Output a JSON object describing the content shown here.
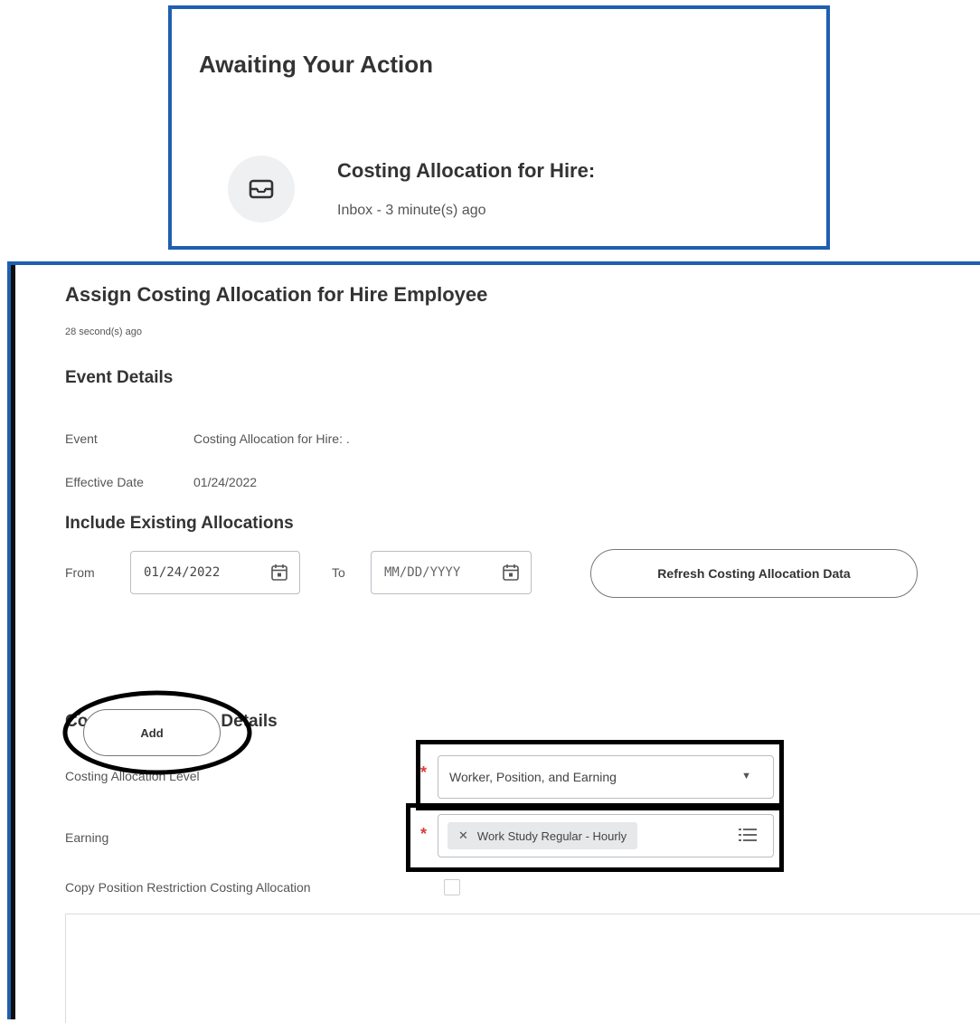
{
  "awaiting": {
    "title": "Awaiting Your Action",
    "item_title": "Costing Allocation for Hire:",
    "item_subtitle": "Inbox - 3 minute(s) ago"
  },
  "task": {
    "title": "Assign Costing Allocation for Hire Employee",
    "timestamp": "28 second(s) ago",
    "event_details": {
      "heading": "Event Details",
      "event_label": "Event",
      "event_value": "Costing Allocation for Hire: .",
      "effective_date_label": "Effective Date",
      "effective_date_value": "01/24/2022"
    },
    "existing": {
      "heading": "Include Existing Allocations",
      "from_label": "From",
      "from_value": "01/24/2022",
      "to_label": "To",
      "to_placeholder": "MM/DD/YYYY",
      "refresh_button": "Refresh Costing Allocation Data"
    },
    "details": {
      "heading": "Costing Allocation Details",
      "level_label": "Costing Allocation Level",
      "level_value": "Worker, Position, and Earning",
      "earning_label": "Earning",
      "earning_value": "Work Study Regular - Hourly",
      "copy_label": "Copy Position Restriction Costing Allocation",
      "copy_checked": false
    },
    "add_button": "Add"
  },
  "colors": {
    "frame_blue": "#1f5fb0",
    "required_red": "#d93d3d",
    "highlight_black": "#000000"
  },
  "icons": [
    "inbox-icon",
    "calendar-icon",
    "dropdown-arrow-icon",
    "remove-x-icon",
    "list-icon"
  ]
}
